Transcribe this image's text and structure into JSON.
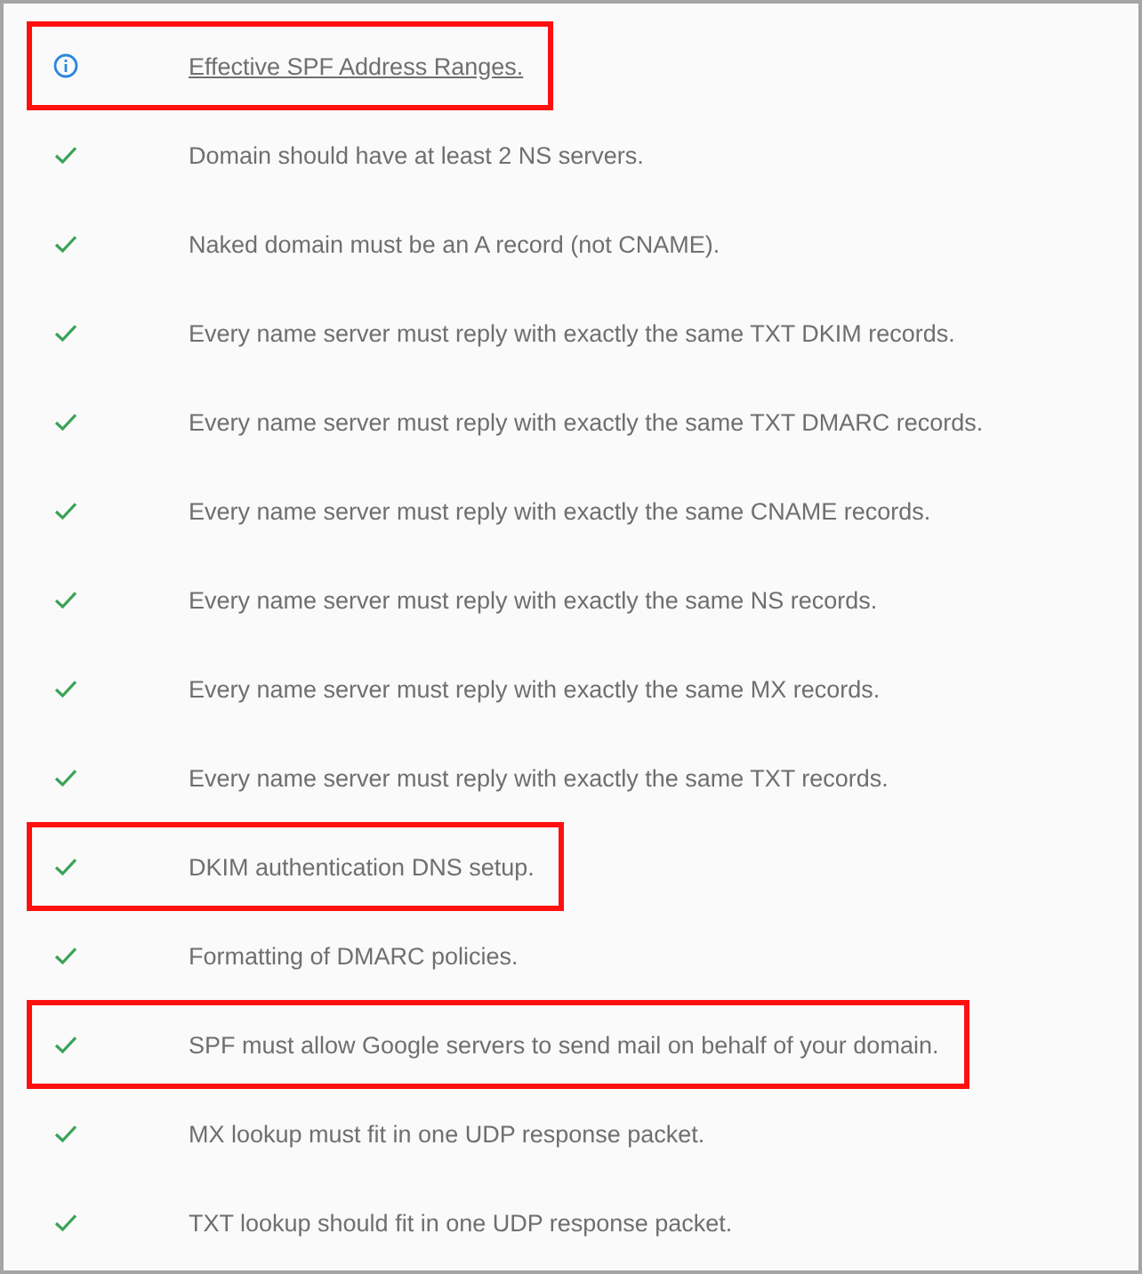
{
  "checks": [
    {
      "kind": "info",
      "text": "Effective SPF Address Ranges.",
      "link": true,
      "highlighted": true
    },
    {
      "kind": "pass",
      "text": "Domain should have at least 2 NS servers.",
      "link": false,
      "highlighted": false
    },
    {
      "kind": "pass",
      "text": "Naked domain must be an A record (not CNAME).",
      "link": false,
      "highlighted": false
    },
    {
      "kind": "pass",
      "text": "Every name server must reply with exactly the same TXT DKIM records.",
      "link": false,
      "highlighted": false
    },
    {
      "kind": "pass",
      "text": "Every name server must reply with exactly the same TXT DMARC records.",
      "link": false,
      "highlighted": false
    },
    {
      "kind": "pass",
      "text": "Every name server must reply with exactly the same CNAME records.",
      "link": false,
      "highlighted": false
    },
    {
      "kind": "pass",
      "text": "Every name server must reply with exactly the same NS records.",
      "link": false,
      "highlighted": false
    },
    {
      "kind": "pass",
      "text": "Every name server must reply with exactly the same MX records.",
      "link": false,
      "highlighted": false
    },
    {
      "kind": "pass",
      "text": "Every name server must reply with exactly the same TXT records.",
      "link": false,
      "highlighted": false
    },
    {
      "kind": "pass",
      "text": "DKIM authentication DNS setup.",
      "link": false,
      "highlighted": true
    },
    {
      "kind": "pass",
      "text": "Formatting of DMARC policies.",
      "link": false,
      "highlighted": false
    },
    {
      "kind": "pass",
      "text": "SPF must allow Google servers to send mail on behalf of your domain.",
      "link": false,
      "highlighted": true
    },
    {
      "kind": "pass",
      "text": "MX lookup must fit in one UDP response packet.",
      "link": false,
      "highlighted": false
    },
    {
      "kind": "pass",
      "text": "TXT lookup should fit in one UDP response packet.",
      "link": false,
      "highlighted": false
    }
  ]
}
